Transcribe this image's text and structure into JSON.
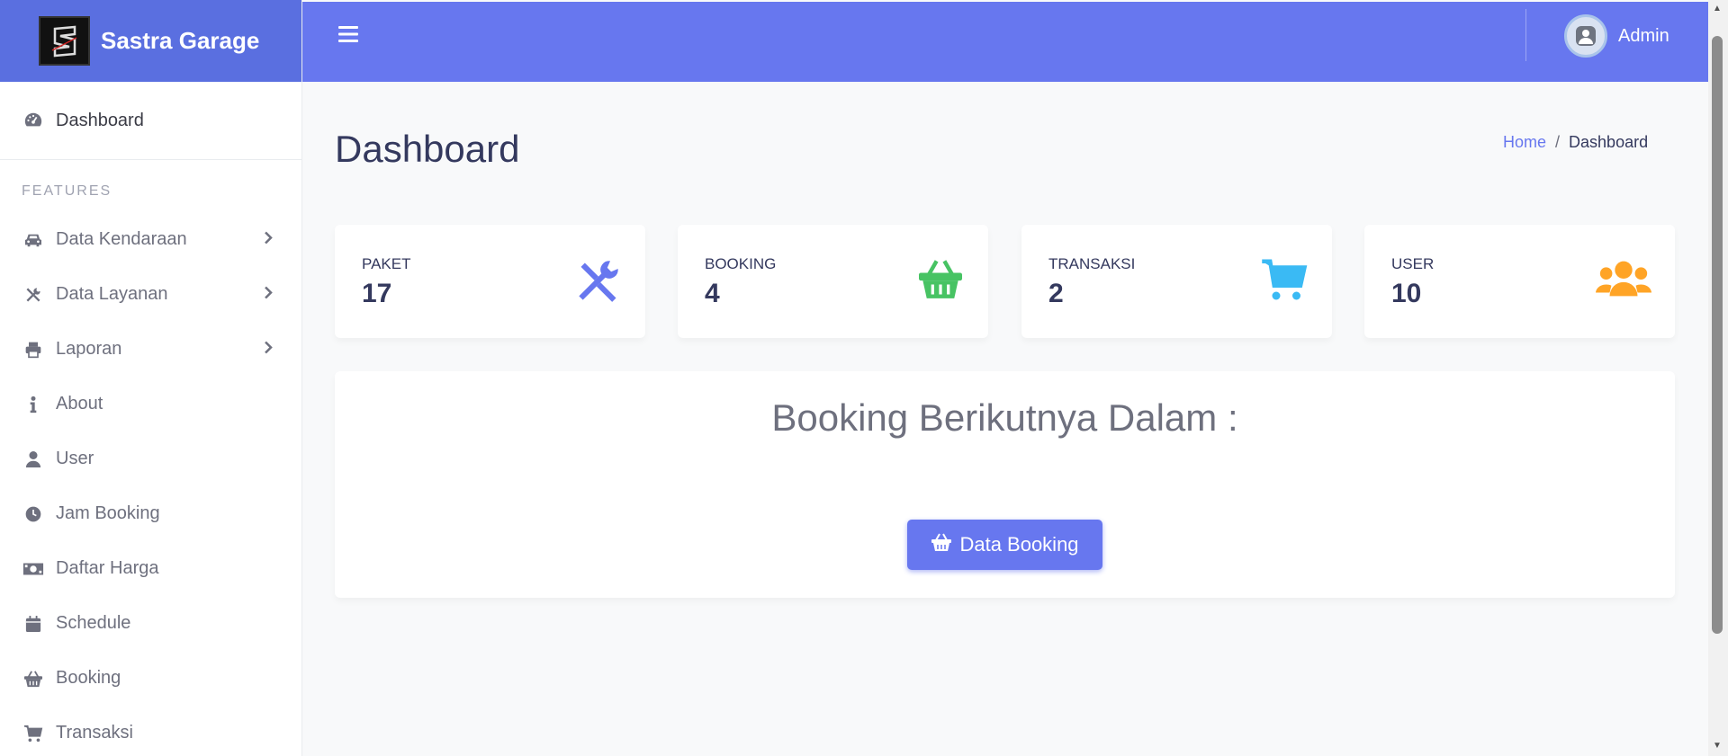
{
  "brand": {
    "name": "Sastra Garage"
  },
  "header": {
    "user_name": "Admin"
  },
  "sidebar": {
    "dashboard": "Dashboard",
    "section": "FEATURES",
    "items": [
      {
        "label": "Data Kendaraan",
        "icon": "car-icon",
        "has_submenu": true
      },
      {
        "label": "Data Layanan",
        "icon": "tools-icon",
        "has_submenu": true
      },
      {
        "label": "Laporan",
        "icon": "printer-icon",
        "has_submenu": true
      },
      {
        "label": "About",
        "icon": "info-icon",
        "has_submenu": false
      },
      {
        "label": "User",
        "icon": "user-icon",
        "has_submenu": false
      },
      {
        "label": "Jam Booking",
        "icon": "clock-icon",
        "has_submenu": false
      },
      {
        "label": "Daftar Harga",
        "icon": "money-icon",
        "has_submenu": false
      },
      {
        "label": "Schedule",
        "icon": "calendar-icon",
        "has_submenu": false
      },
      {
        "label": "Booking",
        "icon": "basket-icon",
        "has_submenu": false
      },
      {
        "label": "Transaksi",
        "icon": "cart-icon",
        "has_submenu": false
      }
    ]
  },
  "page": {
    "title": "Dashboard",
    "breadcrumb": {
      "home": "Home",
      "separator": "/",
      "current": "Dashboard"
    }
  },
  "stats": [
    {
      "label": "PAKET",
      "value": "17",
      "icon": "tools-icon",
      "color": "#6777ef"
    },
    {
      "label": "BOOKING",
      "value": "4",
      "icon": "basket-icon",
      "color": "#47c363"
    },
    {
      "label": "TRANSAKSI",
      "value": "2",
      "icon": "cart-icon",
      "color": "#3abaf4"
    },
    {
      "label": "USER",
      "value": "10",
      "icon": "users-icon",
      "color": "#ffa426"
    }
  ],
  "booking_panel": {
    "title": "Booking Berikutnya Dalam :",
    "button_label": "Data Booking"
  },
  "colors": {
    "primary": "#6777ef",
    "sidebar_brand": "#5a6fe0"
  }
}
